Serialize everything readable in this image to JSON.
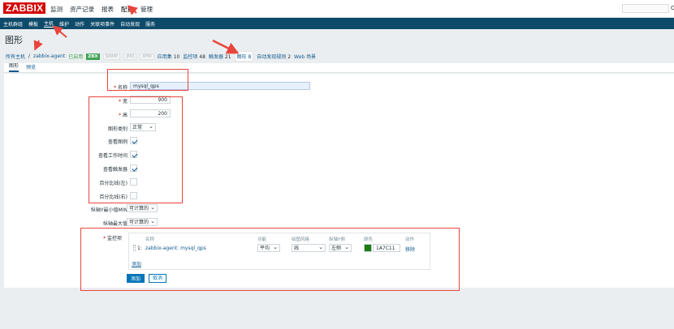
{
  "brand": {
    "logo": "ZABBIX"
  },
  "top_menu": [
    "监测",
    "资产记录",
    "报表",
    "配置",
    "管理"
  ],
  "top_active": "配置",
  "edge_char": "C",
  "sub_menu": [
    "主机群组",
    "模板",
    "主机",
    "维护",
    "动作",
    "关联项事件",
    "自动发现",
    "服务"
  ],
  "sub_active": "主机",
  "page_title": "图形",
  "breadcrumb": {
    "all_hosts": "所有主机",
    "sep": "/",
    "host": "zabbix-agent",
    "status": "已启用",
    "badge_zbx": "ZBX",
    "badge_snmp": "SNMP",
    "badge_jmx": "JMX",
    "badge_ipmi": "IPMI",
    "apps": "应用集",
    "apps_count": "10",
    "items": "监控项",
    "items_count": "48",
    "triggers": "触发器",
    "triggers_count": "21",
    "graphs": "图形",
    "graphs_count": "8",
    "discovery": "自动发现规则",
    "discovery_count": "2",
    "web": "Web 场景"
  },
  "form_tabs": [
    "图形",
    "预览"
  ],
  "form": {
    "name_label": "名称",
    "name_value": "mysql_qps",
    "width_label": "宽",
    "width_value": "900",
    "height_label": "高",
    "height_value": "200",
    "graph_type_label": "图形类别",
    "graph_type_value": "正常",
    "show_legend_label": "查看图例",
    "show_working_time_label": "查看工作时间",
    "show_triggers_label": "查看触发器",
    "percentile_left_label": "百分比线(左)",
    "percentile_right_label": "百分比线(右)",
    "ymin_label": "纵轴Y最小值MIN",
    "ymin_value": "可计算的",
    "ymax_label": "纵轴最大值",
    "ymax_value": "可计算的",
    "items_label": "监控项"
  },
  "items_table": {
    "headers": [
      "名称",
      "功能",
      "绘图风格",
      "纵轴Y侧",
      "颜色",
      "动作"
    ],
    "rows": [
      {
        "index": "1:",
        "name": "zabbix-agent: mysql_qps",
        "function": "平均",
        "style": "线",
        "y_side": "左侧",
        "color": "1A7C11",
        "action": "移除"
      }
    ],
    "add_link": "添加"
  },
  "buttons": {
    "add": "添加",
    "cancel": "取消"
  },
  "colors": {
    "logo": "#d40000",
    "subnav": "#0e4b6a",
    "link": "#0f5a8f",
    "status_enabled": "#429e47",
    "swatch": "#1A7C11",
    "annotation": "#e8453c",
    "primary_button": "#0275b8"
  }
}
